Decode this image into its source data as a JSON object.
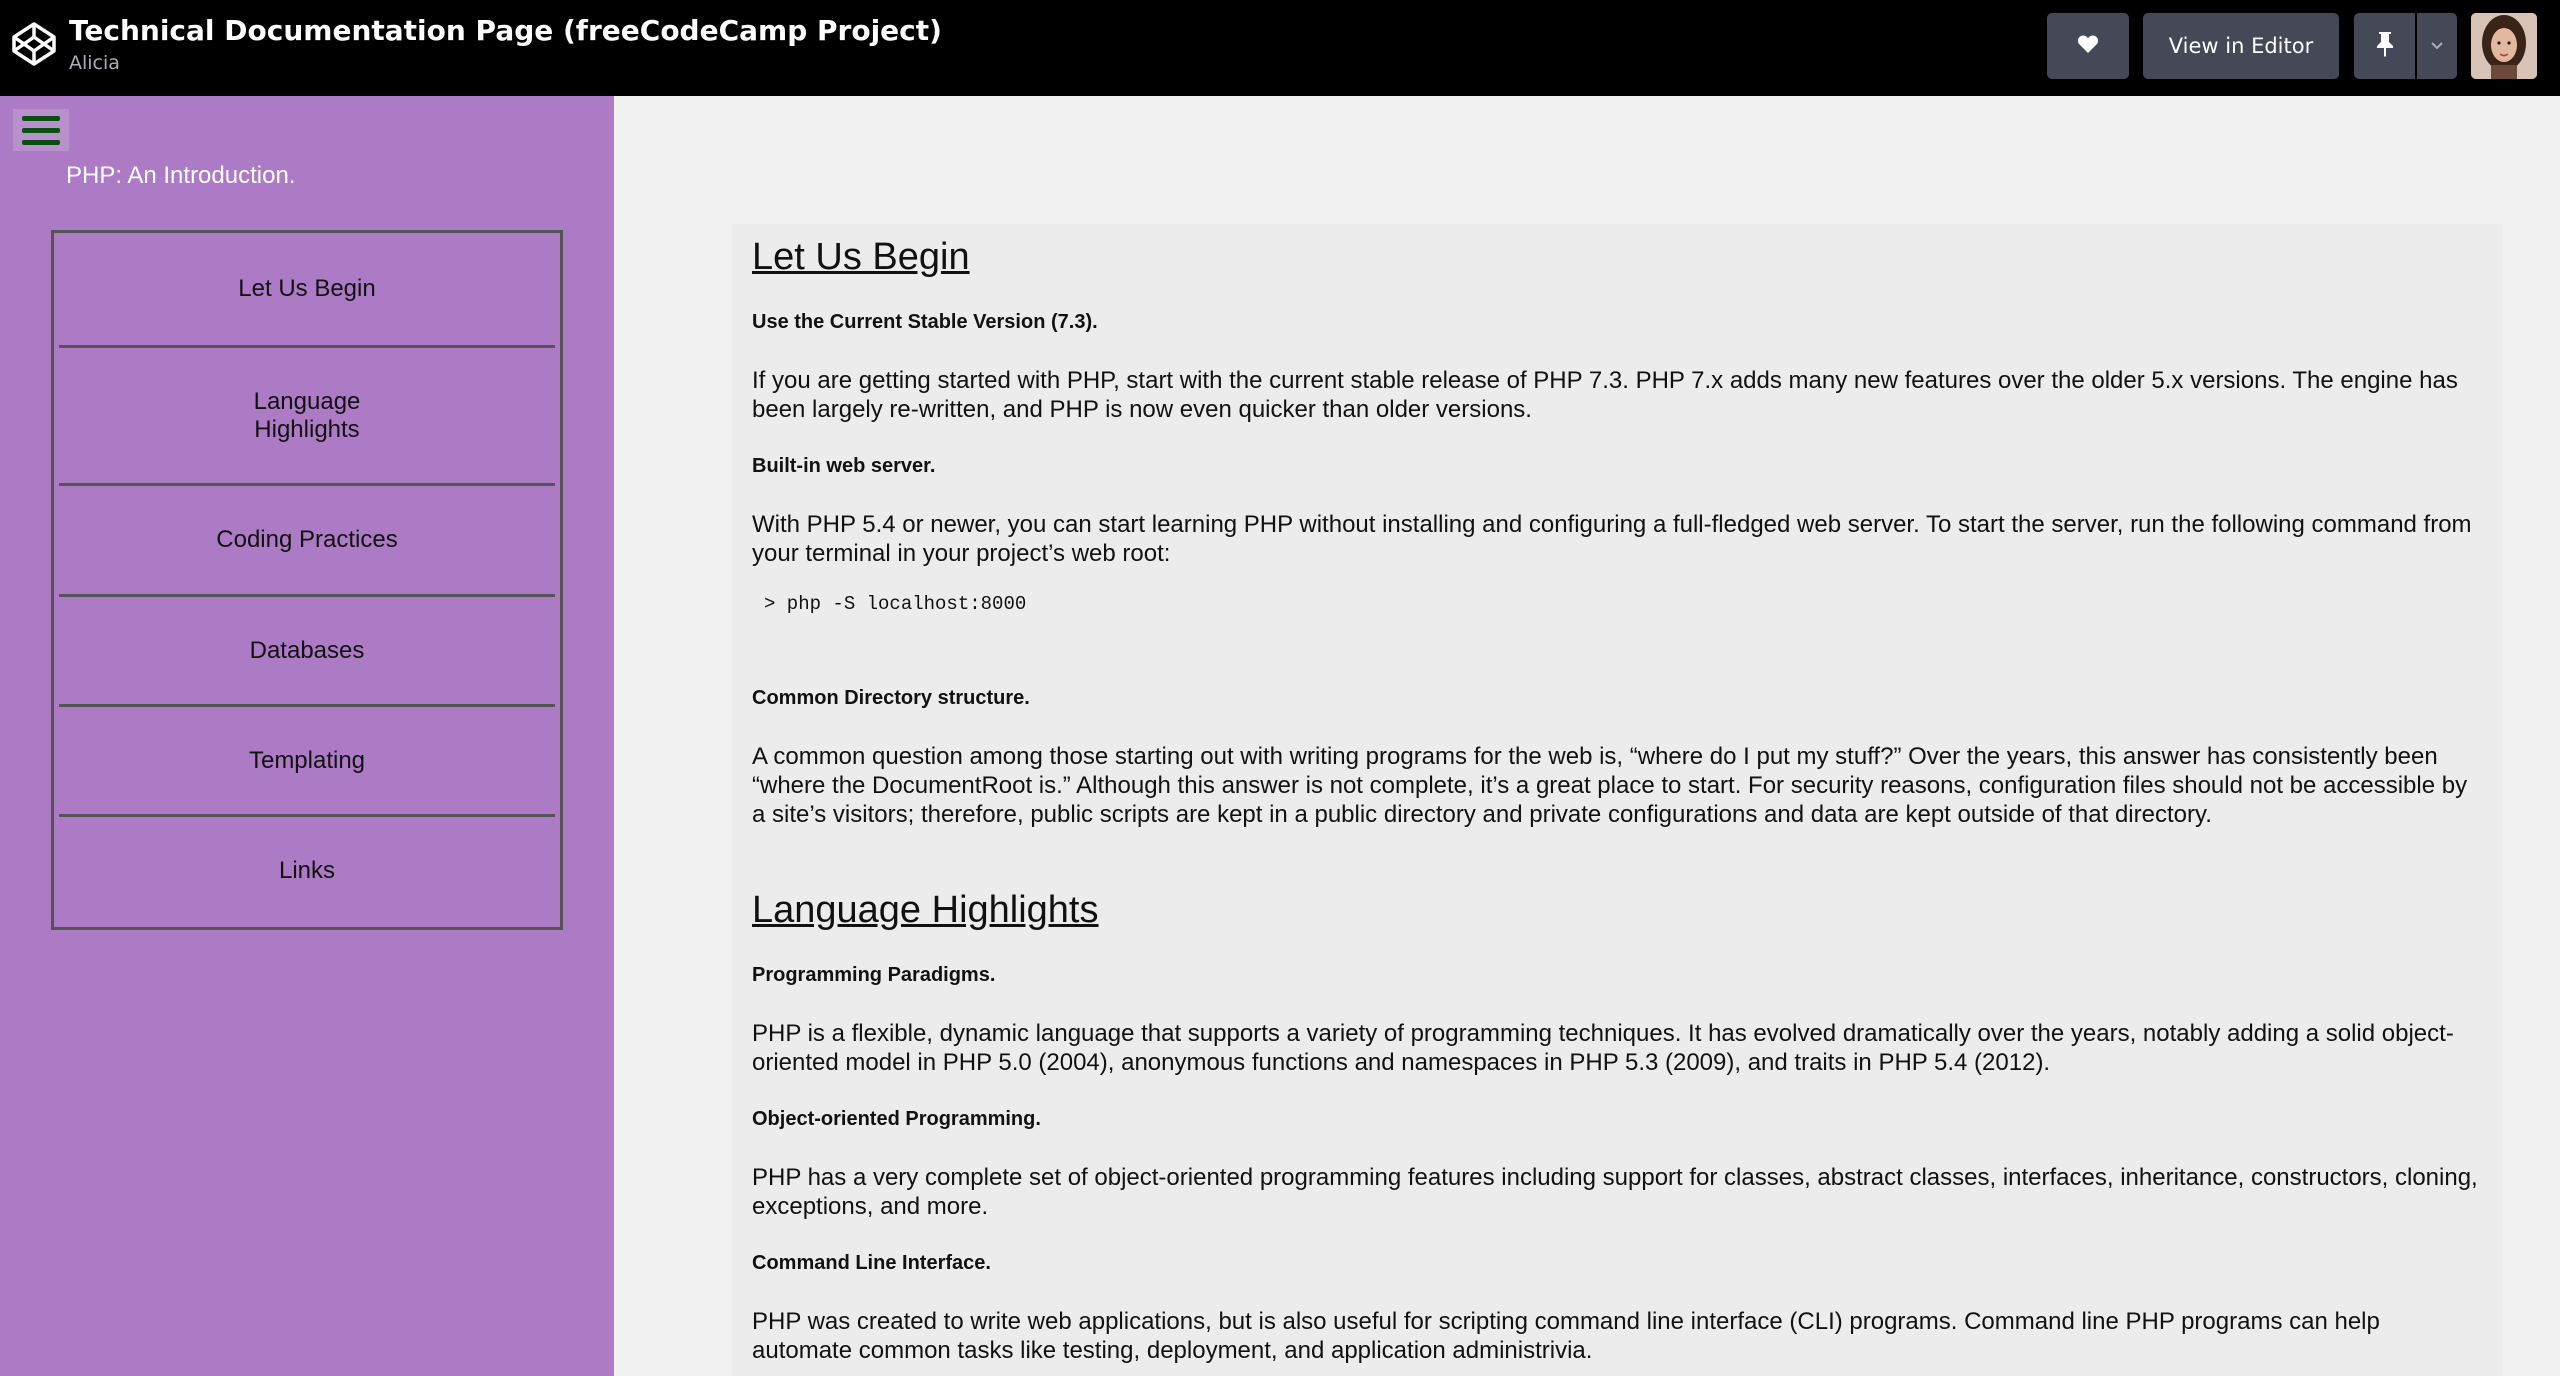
{
  "header": {
    "title": "Technical Documentation Page (freeCodeCamp Project)",
    "author": "Alicia",
    "view_in_editor_label": "View in Editor"
  },
  "nav": {
    "header": "PHP: An Introduction.",
    "items": [
      {
        "label": "Let Us Begin"
      },
      {
        "label": "Language\nHighlights"
      },
      {
        "label": "Coding Practices"
      },
      {
        "label": "Databases"
      },
      {
        "label": "Templating"
      },
      {
        "label": "Links"
      }
    ]
  },
  "sections": [
    {
      "title": "Let Us Begin",
      "subsections": [
        {
          "heading": "Use the Current Stable Version (7.3).",
          "text": "If you are getting started with PHP, start with the current stable release of PHP 7.3. PHP 7.x adds many new features over the older 5.x versions. The engine has been largely re-written, and PHP is now even quicker than older versions."
        },
        {
          "heading": "Built-in web server.",
          "text": "With PHP 5.4 or newer, you can start learning PHP without installing and configuring a full-fledged web server. To start the server, run the following command from your terminal in your project’s web root:",
          "code": "> php -S localhost:8000"
        },
        {
          "heading": "Common Directory structure.",
          "text": "A common question among those starting out with writing programs for the web is, “where do I put my stuff?” Over the years, this answer has consistently been “where the DocumentRoot is.” Although this answer is not complete, it’s a great place to start. For security reasons, configuration files should not be accessible by a site’s visitors; therefore, public scripts are kept in a public directory and private configurations and data are kept outside of that directory."
        }
      ]
    },
    {
      "title": "Language Highlights",
      "subsections": [
        {
          "heading": "Programming Paradigms.",
          "text": "PHP is a flexible, dynamic language that supports a variety of programming techniques. It has evolved dramatically over the years, notably adding a solid object-oriented model in PHP 5.0 (2004), anonymous functions and namespaces in PHP 5.3 (2009), and traits in PHP 5.4 (2012)."
        },
        {
          "heading": "Object-oriented Programming.",
          "text": "PHP has a very complete set of object-oriented programming features including support for classes, abstract classes, interfaces, inheritance, constructors, cloning, exceptions, and more."
        },
        {
          "heading": "Command Line Interface.",
          "text": "PHP was created to write web applications, but is also useful for scripting command line interface (CLI) programs. Command line PHP programs can help automate common tasks like testing, deployment, and application administrivia."
        }
      ]
    }
  ],
  "colors": {
    "topbar": "#000000",
    "sidebar": "#ad7ac5",
    "hamburger_lines": "#0b4d12",
    "content_bg": "#ececec"
  },
  "icons": {
    "logo": "codepen-logo-icon",
    "heart": "heart-icon",
    "pin": "pin-icon",
    "dropdown": "chevron-down-icon",
    "menu": "hamburger-menu-icon"
  }
}
